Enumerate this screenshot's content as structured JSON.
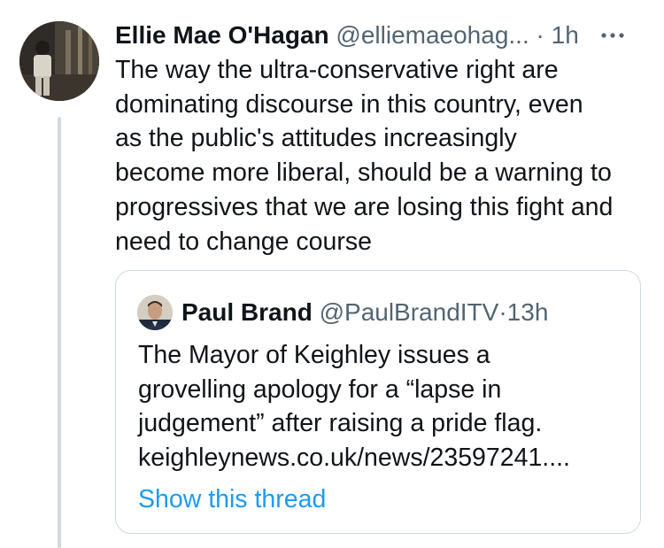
{
  "tweet": {
    "author_name": "Ellie Mae O'Hagan",
    "author_handle": "@elliemaeohag...",
    "separator": "·",
    "time": "1h",
    "more_icon": "more-horizontal-icon",
    "text": "The way the ultra-conservative right are\ndominating discourse in this country, even\nas the public's attitudes increasingly\nbecome more liberal, should be a warning to\nprogressives that we are losing this fight and\nneed to change course"
  },
  "quote": {
    "author_name": "Paul Brand",
    "author_handle": "@PaulBrandITV",
    "separator": "·",
    "time": "13h",
    "lines": [
      "The Mayor of Keighley issues a",
      "grovelling apology for a “lapse in",
      "judgement” after raising a pride flag.",
      "keighleynews.co.uk/news/23597241...."
    ],
    "show_thread": "Show this thread"
  },
  "colors": {
    "text_primary": "#0f1419",
    "text_secondary": "#536471",
    "link": "#1d9bf0",
    "border": "#cfd9de"
  }
}
